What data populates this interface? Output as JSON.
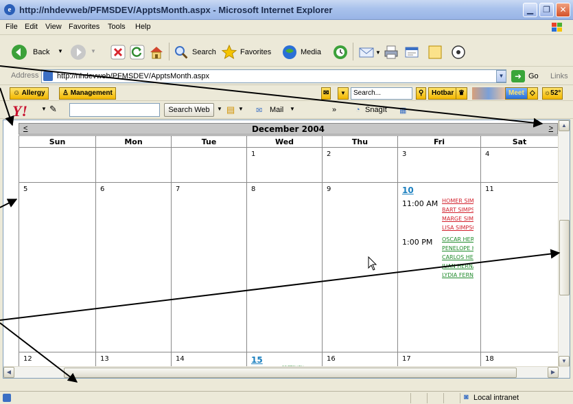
{
  "window": {
    "title": "http://nhdevweb/PFMSDEV/ApptsMonth.aspx - Microsoft Internet Explorer",
    "app_icon": "e",
    "minimize": "▁",
    "maximize": "❐",
    "close": "✕"
  },
  "menu": [
    "File",
    "Edit",
    "View",
    "Favorites",
    "Tools",
    "Help"
  ],
  "toolbar": {
    "back": "Back",
    "search": "Search",
    "favorites": "Favorites",
    "media": "Media"
  },
  "address": {
    "label": "Address",
    "value": "http://nhdevweb/PFMSDEV/ApptsMonth.aspx",
    "go": "Go",
    "links": "Links"
  },
  "hotbar": {
    "allergy": "Allergy",
    "management": "Management",
    "search_placeholder": "Search...",
    "hotbar_label": "Hotbar",
    "meet": "Meet",
    "weather": "52°"
  },
  "yahoo": {
    "logo": "Y!",
    "search_button": "Search Web",
    "mail": "Mail",
    "more": "»",
    "snagit": "SnagIt"
  },
  "calendar": {
    "title": "December 2004",
    "prev": "<",
    "next": ">",
    "days": [
      "Sun",
      "Mon",
      "Tue",
      "Wed",
      "Thu",
      "Fri",
      "Sat"
    ],
    "weeks": [
      [
        {
          "num": ""
        },
        {
          "num": ""
        },
        {
          "num": ""
        },
        {
          "num": "1"
        },
        {
          "num": "2"
        },
        {
          "num": "3"
        },
        {
          "num": "4"
        }
      ],
      [
        {
          "num": "5"
        },
        {
          "num": "6"
        },
        {
          "num": "7"
        },
        {
          "num": "8"
        },
        {
          "num": "9"
        },
        {
          "num": "10",
          "today": true,
          "appts": [
            {
              "time": "11:00 AM",
              "names": [
                {
                  "text": "HOMER SIMPSON",
                  "color": "red"
                },
                {
                  "text": "BART SIMPSON",
                  "color": "red"
                },
                {
                  "text": "MARGE SIMPSON",
                  "color": "red"
                },
                {
                  "text": "LISA SIMPSON",
                  "color": "red"
                }
              ]
            },
            {
              "time": "1:00 PM",
              "names": [
                {
                  "text": "OSCAR HERNANDEZ",
                  "color": "green"
                },
                {
                  "text": "PENELOPE HERNANDEZ",
                  "color": "green"
                },
                {
                  "text": "CARLOS HERNANDEZ",
                  "color": "green"
                },
                {
                  "text": "JUAN HERNANDEZ",
                  "color": "green"
                },
                {
                  "text": "LYDIA FERNANDEZ",
                  "color": "green"
                }
              ]
            }
          ]
        },
        {
          "num": "11"
        }
      ],
      [
        {
          "num": "12"
        },
        {
          "num": "13"
        },
        {
          "num": "14"
        },
        {
          "num": "15",
          "today": true,
          "partial": "GRETCHEN"
        },
        {
          "num": "16"
        },
        {
          "num": "17"
        },
        {
          "num": "18"
        }
      ]
    ]
  },
  "status": {
    "zone": "Local intranet"
  }
}
